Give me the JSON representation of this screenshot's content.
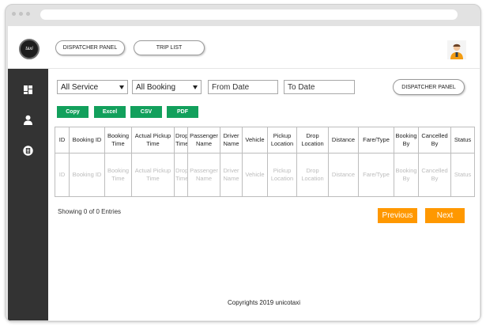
{
  "browser": {},
  "header": {
    "logo_text": "taxi",
    "buttons": [
      "DISPATCHER PANEL",
      "TRIP LIST"
    ]
  },
  "sidebar": {
    "items": [
      {
        "icon": "dashboard-icon"
      },
      {
        "icon": "user-icon"
      },
      {
        "icon": "document-icon"
      }
    ]
  },
  "filters": {
    "service": "All Service",
    "booking": "All Booking",
    "from_date_placeholder": "From Date",
    "to_date_placeholder": "To Date",
    "dispatcher_button": "DISPATCHER PANEL"
  },
  "export_buttons": [
    "Copy",
    "Excel",
    "CSV",
    "PDF"
  ],
  "table": {
    "headers": [
      "ID",
      "Booking ID",
      "Booking Time",
      "Actual Pickup Time",
      "Drop Time",
      "Passenger Name",
      "Driver Name",
      "Vehicle",
      "Pickup Location",
      "Drop Location",
      "Distance",
      "Fare/Type",
      "Booking By",
      "Cancelled By",
      "Status"
    ],
    "placeholder_row": [
      "ID",
      "Booking ID",
      "Booking Time",
      "Actual Pickup Time",
      "Drop Time",
      "Passenger Name",
      "Driver Name",
      "Vehicle",
      "Pickup Location",
      "Drop Location",
      "Distance",
      "Fare/Type",
      "Booking By",
      "Cancelled By",
      "Status"
    ]
  },
  "pagination": {
    "showing": "Showing 0 of 0 Entries",
    "previous": "Previous",
    "next": "Next"
  },
  "footer": {
    "text": "Copyrights 2019 unicotaxi"
  },
  "colors": {
    "sidebar": "#333333",
    "export_green": "#12a05c",
    "pager_orange": "#ff9800"
  }
}
